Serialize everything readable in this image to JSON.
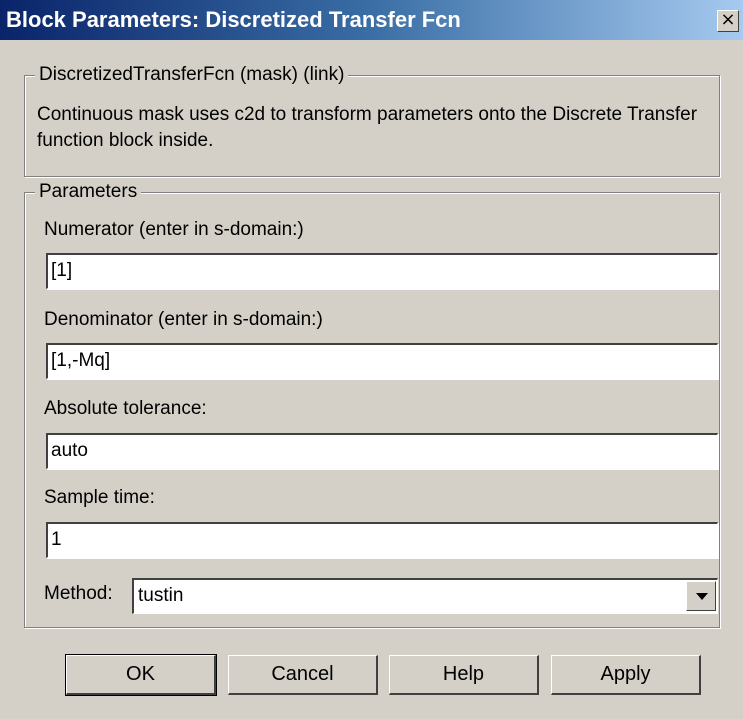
{
  "window": {
    "title": "Block Parameters: Discretized Transfer Fcn",
    "close_glyph": "×"
  },
  "description_group": {
    "legend": "DiscretizedTransferFcn (mask) (link)",
    "text": "Continuous mask uses c2d to transform parameters onto the Discrete Transfer function block inside."
  },
  "parameters_group": {
    "legend": "Parameters",
    "numerator": {
      "label": "Numerator (enter in s-domain:)",
      "value": "[1]"
    },
    "denominator": {
      "label": "Denominator (enter in s-domain:)",
      "value": "[1,-Mq]"
    },
    "abs_tol": {
      "label": "Absolute tolerance:",
      "value": "auto"
    },
    "sample_time": {
      "label": "Sample time:",
      "value": "1"
    },
    "method": {
      "label": "Method:",
      "selected": "tustin"
    }
  },
  "buttons": {
    "ok": "OK",
    "cancel": "Cancel",
    "help": "Help",
    "apply": "Apply"
  },
  "colors": {
    "face": "#d4d0c8",
    "title_start": "#0a246a",
    "title_end": "#a6caf0"
  }
}
